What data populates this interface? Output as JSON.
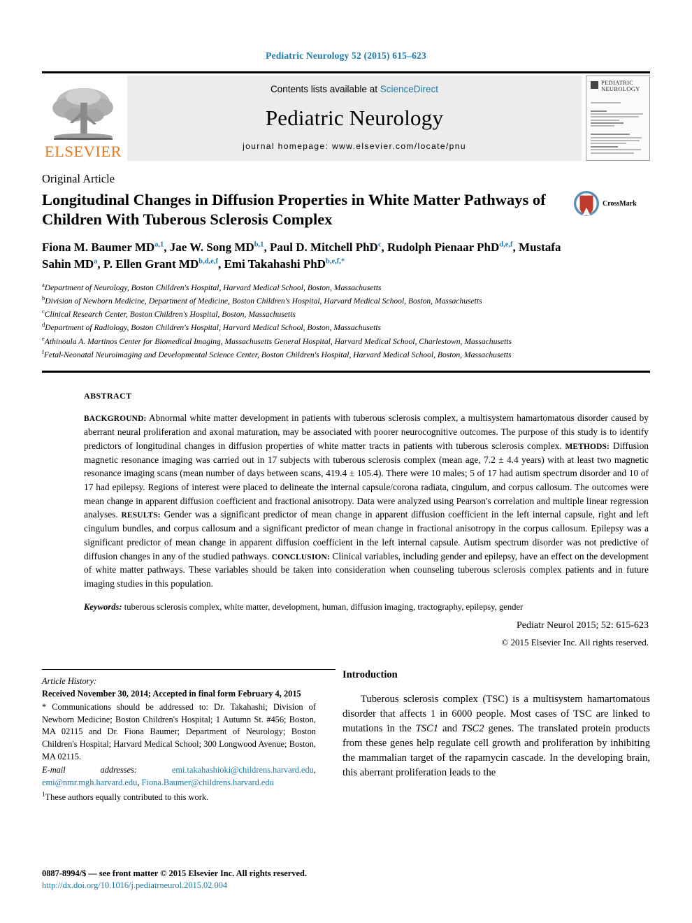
{
  "running_head": "Pediatric Neurology 52 (2015) 615–623",
  "masthead": {
    "contents_prefix": "Contents lists available at ",
    "sciencedirect": "ScienceDirect",
    "journal_name": "Pediatric Neurology",
    "homepage": "journal homepage: www.elsevier.com/locate/pnu",
    "publisher_logo_text": "ELSEVIER",
    "cover_title_line1": "PEDIATRIC",
    "cover_title_line2": "NEUROLOGY"
  },
  "article": {
    "type": "Original Article",
    "title": "Longitudinal Changes in Diffusion Properties in White Matter Pathways of Children With Tuberous Sclerosis Complex",
    "crossmark_label": "CrossMark",
    "authors_html": "Fiona M. Baumer MD<sup>a,1</sup>, Jae W. Song MD<sup>b,1</sup>, Paul D. Mitchell PhD<sup>c</sup>, Rudolph Pienaar PhD<sup>d,e,f</sup>, Mustafa Sahin MD<sup>a</sup>, P. Ellen Grant MD<sup>b,d,e,f</sup>, Emi Takahashi PhD<sup>b,e,f,*</sup>",
    "affiliations": [
      {
        "marker": "a",
        "text": "Department of Neurology, Boston Children's Hospital, Harvard Medical School, Boston, Massachusetts"
      },
      {
        "marker": "b",
        "text": "Division of Newborn Medicine, Department of Medicine, Boston Children's Hospital, Harvard Medical School, Boston, Massachusetts"
      },
      {
        "marker": "c",
        "text": "Clinical Research Center, Boston Children's Hospital, Boston, Massachusetts"
      },
      {
        "marker": "d",
        "text": "Department of Radiology, Boston Children's Hospital, Harvard Medical School, Boston, Massachusetts"
      },
      {
        "marker": "e",
        "text": "Athinoula A. Martinos Center for Biomedical Imaging, Massachusetts General Hospital, Harvard Medical School, Charlestown, Massachusetts"
      },
      {
        "marker": "f",
        "text": "Fetal-Neonatal Neuroimaging and Developmental Science Center, Boston Children's Hospital, Harvard Medical School, Boston, Massachusetts"
      }
    ]
  },
  "abstract": {
    "label": "ABSTRACT",
    "sections": [
      {
        "head": "BACKGROUND:",
        "text": " Abnormal white matter development in patients with tuberous sclerosis complex, a multisystem hamartomatous disorder caused by aberrant neural proliferation and axonal maturation, may be associated with poorer neurocognitive outcomes. The purpose of this study is to identify predictors of longitudinal changes in diffusion properties of white matter tracts in patients with tuberous sclerosis complex. "
      },
      {
        "head": "METHODS:",
        "text": " Diffusion magnetic resonance imaging was carried out in 17 subjects with tuberous sclerosis complex (mean age, 7.2 ± 4.4 years) with at least two magnetic resonance imaging scans (mean number of days between scans, 419.4 ± 105.4). There were 10 males; 5 of 17 had autism spectrum disorder and 10 of 17 had epilepsy. Regions of interest were placed to delineate the internal capsule/corona radiata, cingulum, and corpus callosum. The outcomes were mean change in apparent diffusion coefficient and fractional anisotropy. Data were analyzed using Pearson's correlation and multiple linear regression analyses. "
      },
      {
        "head": "RESULTS:",
        "text": " Gender was a significant predictor of mean change in apparent diffusion coefficient in the left internal capsule, right and left cingulum bundles, and corpus callosum and a significant predictor of mean change in fractional anisotropy in the corpus callosum. Epilepsy was a significant predictor of mean change in apparent diffusion coefficient in the left internal capsule. Autism spectrum disorder was not predictive of diffusion changes in any of the studied pathways. "
      },
      {
        "head": "CONCLUSION:",
        "text": " Clinical variables, including gender and epilepsy, have an effect on the development of white matter pathways. These variables should be taken into consideration when counseling tuberous sclerosis complex patients and in future imaging studies in this population."
      }
    ],
    "keywords_label": "Keywords:",
    "keywords": " tuberous sclerosis complex, white matter, development, human, diffusion imaging, tractography, epilepsy, gender",
    "citation": "Pediatr Neurol 2015; 52: 615-623",
    "copyright": "© 2015 Elsevier Inc. All rights reserved."
  },
  "history": {
    "label": "Article History:",
    "received": "Received November 30, 2014; Accepted in final form February 4, 2015",
    "correspondence": "* Communications should be addressed to: Dr. Takahashi; Division of Newborn Medicine; Boston Children's Hospital; 1 Autumn St. #456; Boston, MA 02115 and Dr. Fiona Baumer; Department of Neurology; Boston Children's Hospital; Harvard Medical School; 300 Longwood Avenue; Boston, MA 02115.",
    "email_label": "E-mail addresses:",
    "emails": [
      "emi.takahashioki@childrens.harvard.edu",
      "emi@nmr.mgh.harvard.edu",
      "Fiona.Baumer@childrens.harvard.edu"
    ],
    "footnote_marker": "1",
    "footnote_text": "These authors equally contributed to this work."
  },
  "introduction": {
    "heading": "Introduction",
    "paragraph_html": "Tuberous sclerosis complex (TSC) is a multisystem hamartomatous disorder that affects 1 in 6000 people. Most cases of TSC are linked to mutations in the <i>TSC1</i> and <i>TSC2</i> genes. The translated protein products from these genes help regulate cell growth and proliferation by inhibiting the mammalian target of the rapamycin cascade. In the developing brain, this aberrant proliferation leads to the"
  },
  "footer": {
    "issn": "0887-8994/$ — see front matter © 2015 Elsevier Inc. All rights reserved.",
    "doi": "http://dx.doi.org/10.1016/j.pediatrneurol.2015.02.004"
  },
  "colors": {
    "link": "#1a7aa8",
    "elsevier_orange": "#e87722",
    "masthead_bg": "#ececec"
  }
}
